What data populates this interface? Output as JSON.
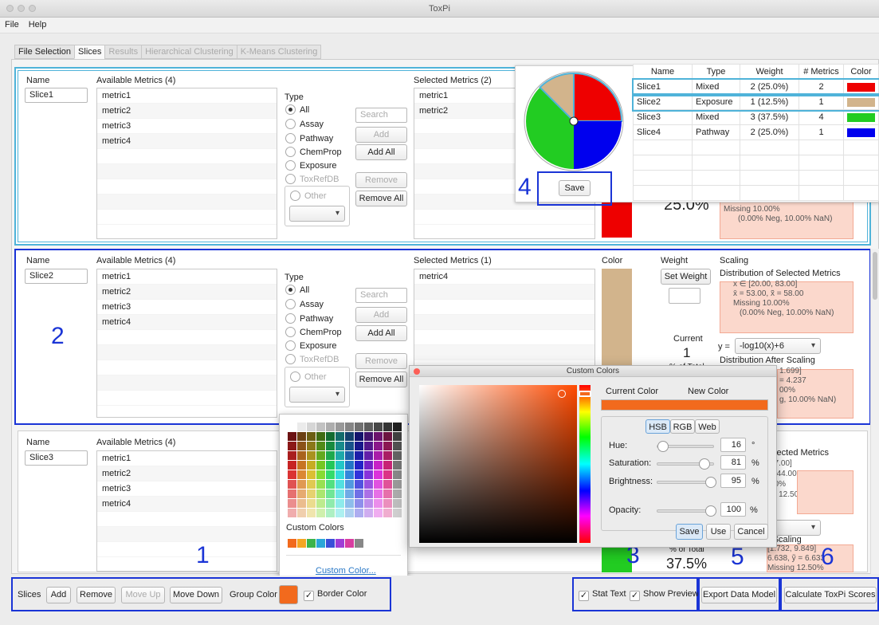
{
  "window": {
    "title": "ToxPi"
  },
  "menu": [
    "File",
    "Help"
  ],
  "tabs": [
    "File Selection",
    "Slices",
    "Results",
    "Hierarchical Clustering",
    "K-Means Clustering"
  ],
  "slice1": {
    "name_label": "Name",
    "name": "Slice1",
    "available_label": "Available Metrics (4)",
    "available": [
      "metric1",
      "metric2",
      "metric3",
      "metric4"
    ],
    "type_label": "Type",
    "types": [
      "All",
      "Assay",
      "Pathway",
      "ChemProp",
      "Exposure",
      "ToxRefDB"
    ],
    "other": "Other",
    "search_placeholder": "Search",
    "add": "Add",
    "add_all": "Add All",
    "remove": "Remove",
    "remove_all": "Remove All",
    "selected_label": "Selected Metrics (2)",
    "selected": [
      "metric1",
      "metric2"
    ],
    "pct": "25.0%",
    "missing": "Missing 10.00%",
    "missing2": "(0.00% Neg, 10.00% NaN)"
  },
  "slice2": {
    "name_label": "Name",
    "name": "Slice2",
    "available_label": "Available Metrics (4)",
    "available": [
      "metric1",
      "metric2",
      "metric3",
      "metric4"
    ],
    "type_label": "Type",
    "types": [
      "All",
      "Assay",
      "Pathway",
      "ChemProp",
      "Exposure",
      "ToxRefDB"
    ],
    "other": "Other",
    "search_placeholder": "Search",
    "add": "Add",
    "add_all": "Add All",
    "remove": "Remove",
    "remove_all": "Remove All",
    "selected_label": "Selected Metrics (1)",
    "selected": [
      "metric4"
    ],
    "color_label": "Color",
    "weight_label": "Weight",
    "set_weight": "Set Weight",
    "current_label": "Current",
    "current": "1",
    "pct_total_label": "% of Total",
    "scaling_label": "Scaling",
    "dist_title": "Distribution of Selected Metrics",
    "dist_range": "x ∈ [20.00, 83.00]",
    "dist_mean": "x̄ = 53.00, x̃ = 58.00",
    "dist_missing": "Missing 10.00%",
    "dist_missing2": "(0.00% Neg, 10.00% NaN)",
    "transform": "-log10(x)+6",
    "transform_prefix": "y =",
    "after_title": "Distribution After Scaling",
    "after_range": "1.699]",
    "after_mean": "= 4.237",
    "after_missing": "00%",
    "after_missing2": "g, 10.00% NaN)"
  },
  "slice3": {
    "name_label": "Name",
    "name": "Slice3",
    "available_label": "Available Metrics (4)",
    "available": [
      "metric1",
      "metric2",
      "metric3",
      "metric4"
    ],
    "pct_total_label": "% of Total",
    "pct": "37.5%",
    "dist_title": "elected Metrics",
    "dist_range": "97.00]",
    "dist_mean": "= 44.00",
    "dist_missing": "50%",
    "dist_missing2": "g, 12.50% NaN)",
    "after_title": "r Scaling",
    "after_range": "[1.732, 9.849]",
    "after_mean": "6.638, ỹ = 6.633",
    "after_missing": "Missing 12.50%"
  },
  "preview": {
    "columns": [
      "Name",
      "Type",
      "Weight",
      "# Metrics",
      "Color"
    ],
    "rows": [
      {
        "name": "Slice1",
        "type": "Mixed",
        "weight": "2 (25.0%)",
        "metrics": "2",
        "color": "#ee0000"
      },
      {
        "name": "Slice2",
        "type": "Exposure",
        "weight": "1 (12.5%)",
        "metrics": "1",
        "color": "#d2b48c"
      },
      {
        "name": "Slice3",
        "type": "Mixed",
        "weight": "3 (37.5%)",
        "metrics": "4",
        "color": "#22cc22"
      },
      {
        "name": "Slice4",
        "type": "Pathway",
        "weight": "2 (25.0%)",
        "metrics": "1",
        "color": "#0000ee"
      }
    ],
    "save": "Save"
  },
  "custom_colors": {
    "title": "Custom Colors",
    "current_label": "Current Color",
    "new_label": "New Color",
    "new_color": "#f26a1d",
    "modes": [
      "HSB",
      "RGB",
      "Web"
    ],
    "hue_label": "Hue:",
    "hue": "16",
    "hue_unit": "°",
    "sat_label": "Saturation:",
    "sat": "81",
    "sat_unit": "%",
    "bri_label": "Brightness:",
    "bri": "95",
    "bri_unit": "%",
    "opacity_label": "Opacity:",
    "opacity": "100",
    "opacity_unit": "%",
    "save": "Save",
    "use": "Use",
    "cancel": "Cancel"
  },
  "palette": {
    "custom_label": "Custom Colors",
    "custom_link": "Custom Color..."
  },
  "bottom": {
    "slices_label": "Slices",
    "add": "Add",
    "remove": "Remove",
    "move_up": "Move Up",
    "move_down": "Move Down",
    "group_color": "Group Color",
    "group_color_value": "#f26a1d",
    "border_color": "Border Color",
    "stat_text": "Stat Text",
    "show_preview": "Show Preview",
    "export": "Export Data Model",
    "calculate": "Calculate ToxPi Scores"
  },
  "annotations": [
    "1",
    "2",
    "3",
    "4",
    "5",
    "6"
  ]
}
